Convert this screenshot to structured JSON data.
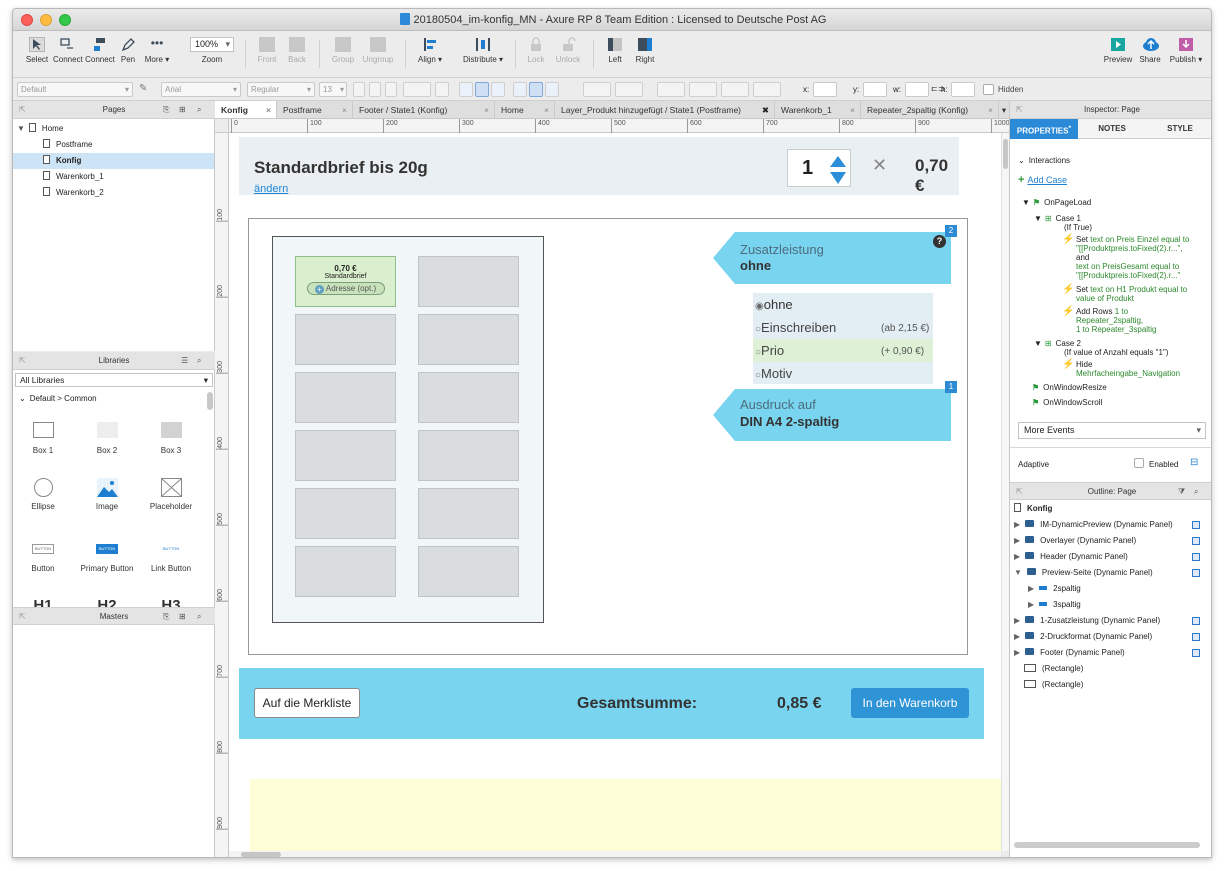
{
  "window": {
    "title": "20180504_im-konfig_MN - Axure RP 8 Team Edition : Licensed to Deutsche Post AG"
  },
  "toolbar": {
    "select": "Select",
    "connect": "Connect",
    "pen": "Pen",
    "more": "More ▾",
    "zoom_value": "100%",
    "zoom": "Zoom",
    "front": "Front",
    "back": "Back",
    "group": "Group",
    "ungroup": "Ungroup",
    "align": "Align ▾",
    "distribute": "Distribute ▾",
    "lock": "Lock",
    "unlock": "Unlock",
    "left": "Left",
    "right": "Right",
    "preview": "Preview",
    "share": "Share",
    "publish": "Publish ▾"
  },
  "format": {
    "style": "Default",
    "font": "Arial",
    "weight": "Regular",
    "size": "13",
    "x": "x:",
    "y": "y:",
    "w": "w:",
    "h": "h:",
    "hidden": "Hidden"
  },
  "pages": {
    "title": "Pages",
    "items": [
      {
        "label": "Home"
      },
      {
        "label": "Postframe"
      },
      {
        "label": "Konfig"
      },
      {
        "label": "Warenkorb_1"
      },
      {
        "label": "Warenkorb_2"
      }
    ]
  },
  "libraries": {
    "title": "Libraries",
    "select": "All Libraries",
    "group": "Default > Common",
    "widgets": [
      {
        "label": "Box 1"
      },
      {
        "label": "Box 2"
      },
      {
        "label": "Box 3"
      },
      {
        "label": "Ellipse"
      },
      {
        "label": "Image"
      },
      {
        "label": "Placeholder"
      },
      {
        "label": "Button"
      },
      {
        "label": "Primary Button"
      },
      {
        "label": "Link Button"
      },
      {
        "label": "H1"
      },
      {
        "label": "H2"
      },
      {
        "label": "H3"
      }
    ],
    "button_text": "BUTTON"
  },
  "masters": {
    "title": "Masters"
  },
  "tabs": [
    {
      "label": "Konfig"
    },
    {
      "label": "Postframe"
    },
    {
      "label": "Footer / State1 (Konfig)"
    },
    {
      "label": "Home"
    },
    {
      "label": "Layer_Produkt hinzugefügt / State1 (Postframe)"
    },
    {
      "label": "Warenkorb_1"
    },
    {
      "label": "Repeater_2spaltig (Konfig)"
    }
  ],
  "ruler": {
    "top": [
      "0",
      "100",
      "200",
      "300",
      "400",
      "500",
      "600",
      "700",
      "800",
      "900",
      "1000"
    ],
    "left": [
      "100",
      "200",
      "300",
      "400",
      "500",
      "600",
      "700",
      "800",
      "900"
    ]
  },
  "design": {
    "title": "Standardbrief bis 20g",
    "change_link": "ändern",
    "quantity": "1",
    "times": "✕",
    "unit_price": "0,70 €",
    "tile_price": "0,70 €",
    "tile_name": "Standardbrief",
    "tile_address": "Adresse (opt.)",
    "zusatz_label": "Zusatzleistung",
    "zusatz_value": "ohne",
    "badge_2": "2",
    "help": "?",
    "options": [
      {
        "label": "ohne",
        "price": ""
      },
      {
        "label": "Einschreiben",
        "price": "(ab 2,15 €)"
      },
      {
        "label": "Prio",
        "price": "(+ 0,90 €)"
      },
      {
        "label": "Motiv",
        "price": ""
      }
    ],
    "ausdruck_label": "Ausdruck auf",
    "ausdruck_value": "DIN A4 2-spaltig",
    "badge_1": "1",
    "merkliste": "Auf die Merkliste",
    "gesamt_label": "Gesamtsumme:",
    "gesamt_value": "0,85 €",
    "warenkorb": "In den Warenkorb"
  },
  "inspector": {
    "title": "Inspector: Page",
    "tabs": [
      "PROPERTIES",
      "NOTES",
      "STYLE"
    ],
    "interactions": "Interactions",
    "add_case": "Add Case",
    "onpageload": "OnPageLoad",
    "case1": "Case 1",
    "case1_cond": "(If True)",
    "a1_l1": "Set",
    "a1_l1b": "text on Preis Einzel equal to",
    "a1_l2": "\"[[Produktpreis.toFixed(2).r...\",",
    "a1_l3": "and",
    "a1_l4": "text on PreisGesamt equal to",
    "a1_l5": "\"[[Produktpreis.toFixed(2).r...\"",
    "a2_l1": "Set",
    "a2_l1b": "text on H1 Produkt equal to",
    "a2_l2": "value of Produkt",
    "a3_l1": "Add Rows",
    "a3_l1b": "1 to",
    "a3_l2": "Repeater_2spaltig,",
    "a3_l3": "1 to Repeater_3spaltig",
    "case2": "Case 2",
    "case2_cond": "(If value of Anzahl equals \"1\")",
    "a4_l1": "Hide",
    "a4_l2": "Mehrfacheingabe_Navigation",
    "onwindowresize": "OnWindowResize",
    "onwindowscroll": "OnWindowScroll",
    "more_events": "More Events",
    "adaptive": "Adaptive",
    "enabled": "Enabled"
  },
  "outline": {
    "title": "Outline: Page",
    "root": "Konfig",
    "items": [
      {
        "label": "IM-DynamicPreview (Dynamic Panel)"
      },
      {
        "label": "Overlayer (Dynamic Panel)"
      },
      {
        "label": "Header (Dynamic Panel)"
      },
      {
        "label": "Preview-Seite (Dynamic Panel)"
      },
      {
        "label": "2spaltig"
      },
      {
        "label": "3spaltig"
      },
      {
        "label": "1-Zusatzleistung (Dynamic Panel)"
      },
      {
        "label": "2-Druckformat (Dynamic Panel)"
      },
      {
        "label": "Footer (Dynamic Panel)"
      },
      {
        "label": "(Rectangle)"
      },
      {
        "label": "(Rectangle)"
      }
    ]
  }
}
